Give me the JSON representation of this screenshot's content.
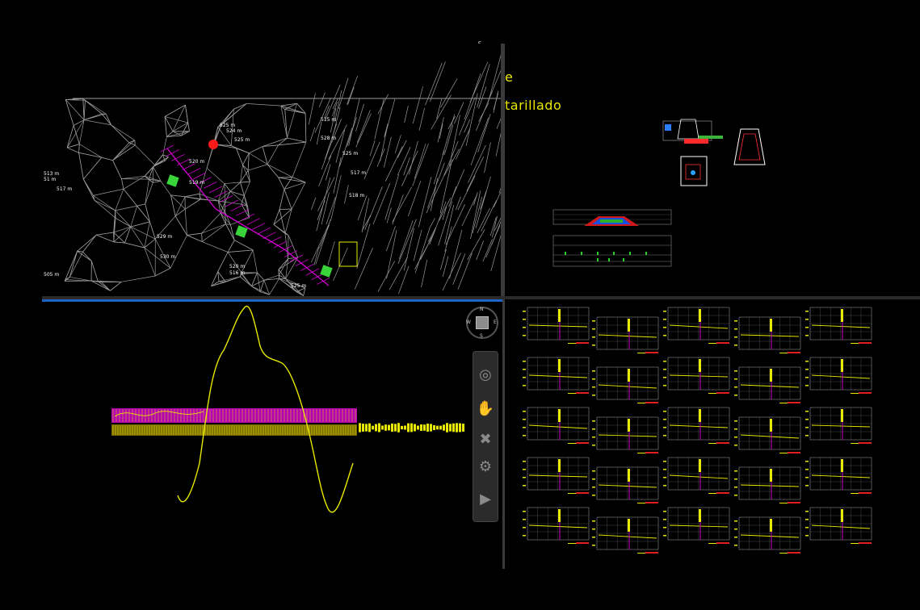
{
  "canvas": {
    "background_color": "#000000",
    "accent_color": "#1e63c8",
    "drawing_color_yellow": "#e8e800",
    "drawing_color_magenta": "#cc00cc",
    "mesh_color": "#9a9a9a"
  },
  "viewport_top_right": {
    "title_line_1": "e",
    "title_line_2": "tarillado"
  },
  "viewport_top_left": {
    "elevation_labels": [
      "513 m",
      "51 m",
      "517 m",
      "505 m",
      "525 m",
      "524 m",
      "525 m",
      "520 m",
      "519 m",
      "515 m",
      "528 m",
      "525 m",
      "517 m",
      "518 m",
      "529 m",
      "530 m",
      "520 m",
      "516 m",
      "525 m"
    ]
  },
  "viewcube": {
    "north_label": "N",
    "south_label": "S",
    "east_label": "E",
    "west_label": "W"
  },
  "compass": {
    "label": "S"
  },
  "navigation_bar": {
    "icons": [
      "steering-wheel-icon",
      "pan-hand-icon",
      "zoom-icon",
      "orbit-icon",
      "showmotion-icon"
    ]
  }
}
